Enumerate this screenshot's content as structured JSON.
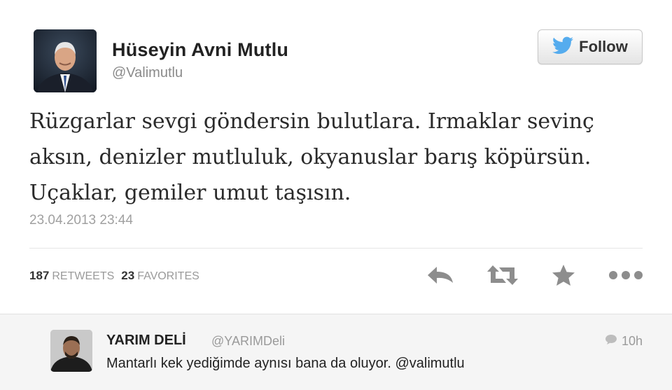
{
  "tweet": {
    "author_name": "Hüseyin Avni Mutlu",
    "author_handle": "@Valimutlu",
    "follow_label": "Follow",
    "text_lines": [
      "Rüzgarlar sevgi göndersin bulutlara. Irmaklar sevinç",
      "aksın, denizler mutluluk, okyanuslar barış köpürsün.",
      "Uçaklar, gemiler umut taşısın."
    ],
    "timestamp": "23.04.2013 23:44",
    "retweets_count": "187",
    "retweets_label": "RETWEETS",
    "favorites_count": "23",
    "favorites_label": "FAVORITES",
    "icons": {
      "follow": "twitter-bird-icon",
      "reply": "reply-icon",
      "retweet": "retweet-icon",
      "favorite": "star-icon",
      "more": "more-icon"
    }
  },
  "reply": {
    "author_name": "YARIM DELİ",
    "author_handle": "@YARIMDeli",
    "text": "Mantarlı kek yediğimde aynısı bana da oluyor. @valimutlu",
    "time": "10h",
    "icon": "speech-bubble-icon"
  },
  "colors": {
    "twitter_blue": "#55acee",
    "icon_gray": "#8d8d8d"
  }
}
